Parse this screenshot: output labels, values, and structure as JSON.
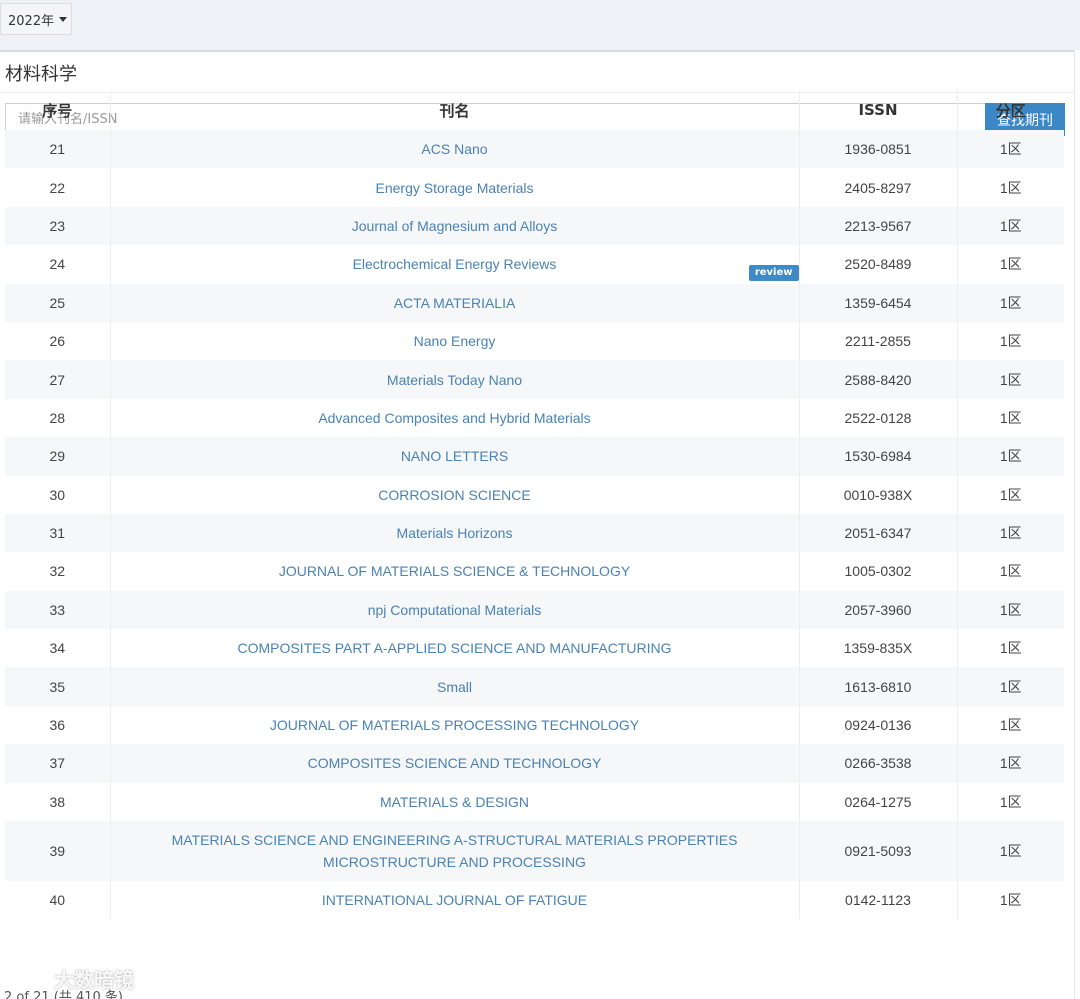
{
  "toolbar": {
    "year": "2022年"
  },
  "panel": {
    "title": "材料科学"
  },
  "search": {
    "placeholder": "请输入刊名/ISSN",
    "button": "查找期刊"
  },
  "table": {
    "headers": {
      "no": "序号",
      "name": "刊名",
      "issn": "ISSN",
      "zone": "分区"
    },
    "rows": [
      {
        "no": "21",
        "name": "ACS Nano",
        "issn": "1936-0851",
        "zone": "1区"
      },
      {
        "no": "22",
        "name": "Energy Storage Materials",
        "issn": "2405-8297",
        "zone": "1区"
      },
      {
        "no": "23",
        "name": "Journal of Magnesium and Alloys",
        "issn": "2213-9567",
        "zone": "1区"
      },
      {
        "no": "24",
        "name": "Electrochemical Energy Reviews",
        "issn": "2520-8489",
        "zone": "1区",
        "badge": "review"
      },
      {
        "no": "25",
        "name": "ACTA MATERIALIA",
        "issn": "1359-6454",
        "zone": "1区"
      },
      {
        "no": "26",
        "name": "Nano Energy",
        "issn": "2211-2855",
        "zone": "1区"
      },
      {
        "no": "27",
        "name": "Materials Today Nano",
        "issn": "2588-8420",
        "zone": "1区"
      },
      {
        "no": "28",
        "name": "Advanced Composites and Hybrid Materials",
        "issn": "2522-0128",
        "zone": "1区"
      },
      {
        "no": "29",
        "name": "NANO LETTERS",
        "issn": "1530-6984",
        "zone": "1区"
      },
      {
        "no": "30",
        "name": "CORROSION SCIENCE",
        "issn": "0010-938X",
        "zone": "1区"
      },
      {
        "no": "31",
        "name": "Materials Horizons",
        "issn": "2051-6347",
        "zone": "1区"
      },
      {
        "no": "32",
        "name": "JOURNAL OF MATERIALS SCIENCE & TECHNOLOGY",
        "issn": "1005-0302",
        "zone": "1区"
      },
      {
        "no": "33",
        "name": "npj Computational Materials",
        "issn": "2057-3960",
        "zone": "1区"
      },
      {
        "no": "34",
        "name": "COMPOSITES PART A-APPLIED SCIENCE AND MANUFACTURING",
        "issn": "1359-835X",
        "zone": "1区"
      },
      {
        "no": "35",
        "name": "Small",
        "issn": "1613-6810",
        "zone": "1区"
      },
      {
        "no": "36",
        "name": "JOURNAL OF MATERIALS PROCESSING TECHNOLOGY",
        "issn": "0924-0136",
        "zone": "1区"
      },
      {
        "no": "37",
        "name": "COMPOSITES SCIENCE AND TECHNOLOGY",
        "issn": "0266-3538",
        "zone": "1区"
      },
      {
        "no": "38",
        "name": "MATERIALS & DESIGN",
        "issn": "0264-1275",
        "zone": "1区"
      },
      {
        "no": "39",
        "name": "MATERIALS SCIENCE AND ENGINEERING A-STRUCTURAL MATERIALS PROPERTIES MICROSTRUCTURE AND PROCESSING",
        "issn": "0921-5093",
        "zone": "1区"
      },
      {
        "no": "40",
        "name": "INTERNATIONAL JOURNAL OF FATIGUE",
        "issn": "0142-1123",
        "zone": "1区"
      }
    ]
  },
  "footer": {
    "pagination": "2 of 21 (共 410 条)"
  },
  "watermark": {
    "text": "大数暗镜"
  },
  "colors": {
    "link": "#4a82b3",
    "accent": "#3c87c6",
    "row_stripe": "#f6f7f9"
  }
}
